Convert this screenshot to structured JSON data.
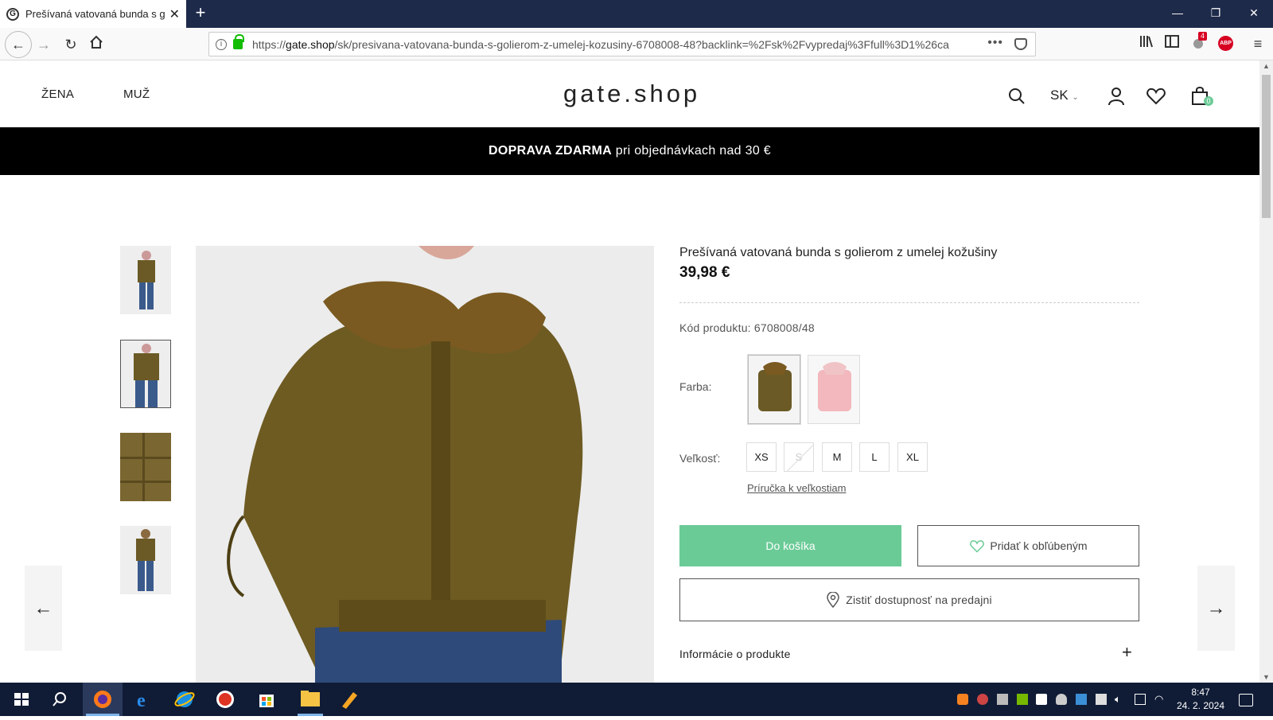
{
  "browser": {
    "tab_title": "Prešívaná vatovaná bunda s go",
    "tab_favicon": "G",
    "url_prefix": "https://",
    "url_host": "gate.shop",
    "url_path": "/sk/presivana-vatovana-bunda-s-golierom-z-umelej-kozusiny-6708008-48?backlink=%2Fsk%2Fvypredaj%3Ffull%3D1%26ca",
    "notification_badge": "4",
    "abp_label": "ABP"
  },
  "header": {
    "nav_women": "ŽENA",
    "nav_men": "MUŽ",
    "logo": "gate.shop",
    "language": "SK",
    "cart_count": "0"
  },
  "banner": {
    "bold": "DOPRAVA ZDARMA",
    "text": " pri objednávkach nad 30 €"
  },
  "product": {
    "title": "Prešívaná vatovaná bunda s golierom z umelej kožušiny",
    "price": "39,98 €",
    "code_label": "Kód produktu: 6708008/48",
    "color_label": "Farba:",
    "size_label": "Veľkosť:",
    "sizes": [
      "XS",
      "S",
      "M",
      "L",
      "XL"
    ],
    "unavailable_size": "S",
    "size_guide": "Príručka k veľkostiam",
    "add_to_cart": "Do košíka",
    "add_to_favorites": "Pridať k obľúbeným",
    "check_availability": "Zistiť dostupnosť na predajni",
    "info_section": "Informácie o produkte",
    "colors": {
      "selected": "#6b5a26",
      "alt": "#f2b8bd"
    }
  },
  "gallery": {
    "prev": "←",
    "next": "→"
  },
  "taskbar": {
    "time": "8:47",
    "date": "24. 2. 2024"
  },
  "colors": {
    "accent": "#6bcb97",
    "tabbar": "#1e2a4a",
    "banner": "#000000"
  }
}
